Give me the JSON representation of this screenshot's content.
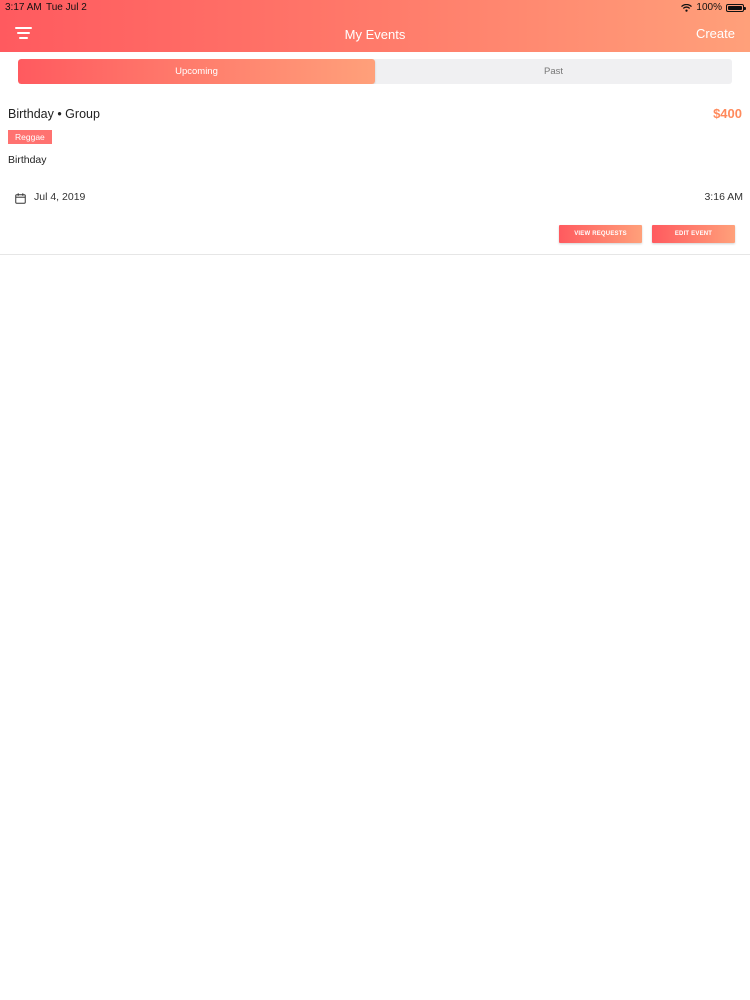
{
  "status_bar": {
    "time": "3:17 AM",
    "date": "Tue Jul 2",
    "battery": "100%"
  },
  "header": {
    "title": "My Events",
    "create_label": "Create",
    "menu_icon": "filter-menu-icon"
  },
  "tabs": [
    {
      "label": "Upcoming",
      "active": true
    },
    {
      "label": "Past",
      "active": false
    }
  ],
  "events": [
    {
      "title": "Birthday • Group",
      "price": "$400",
      "genre": "Reggae",
      "description": "Birthday",
      "date": "Jul 4, 2019",
      "time": "3:16 AM",
      "date_icon": "calendar-icon",
      "actions": {
        "view_requests": "VIEW REQUESTS",
        "edit_event": "EDIT EVENT"
      }
    }
  ],
  "colors": {
    "gradient_start": "#ff5a5f",
    "gradient_end": "#ffa07a",
    "price": "#ff8a5c",
    "badge": "#ff7270"
  }
}
